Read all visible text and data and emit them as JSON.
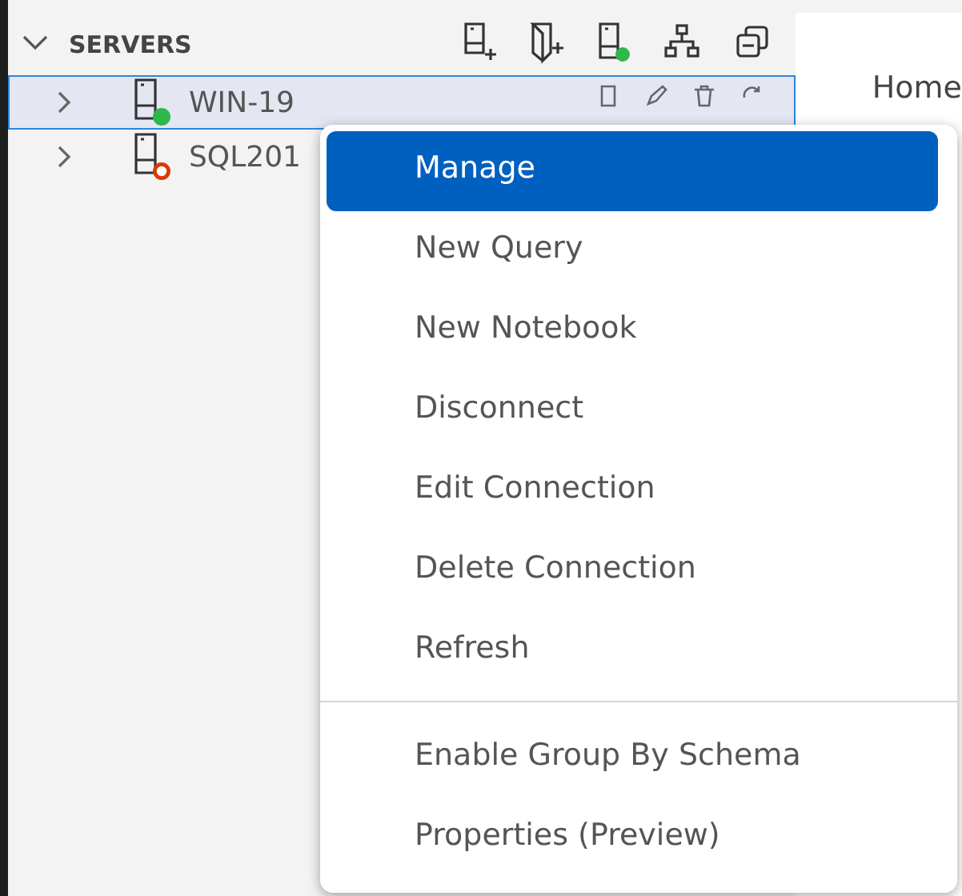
{
  "sidebar": {
    "title": "SERVERS",
    "expanded": true
  },
  "servers": [
    {
      "name": "WIN-19",
      "connected": true,
      "selected": true
    },
    {
      "name": "SQL201",
      "connected": false,
      "selected": false
    }
  ],
  "editor": {
    "tab": "Home"
  },
  "context_menu": {
    "groups": [
      [
        {
          "label": "Manage",
          "selected": true
        },
        {
          "label": "New Query",
          "selected": false
        },
        {
          "label": "New Notebook",
          "selected": false
        },
        {
          "label": "Disconnect",
          "selected": false
        },
        {
          "label": "Edit Connection",
          "selected": false
        },
        {
          "label": "Delete Connection",
          "selected": false
        },
        {
          "label": "Refresh",
          "selected": false
        }
      ],
      [
        {
          "label": "Enable Group By Schema",
          "selected": false
        },
        {
          "label": "Properties (Preview)",
          "selected": false
        }
      ]
    ]
  }
}
